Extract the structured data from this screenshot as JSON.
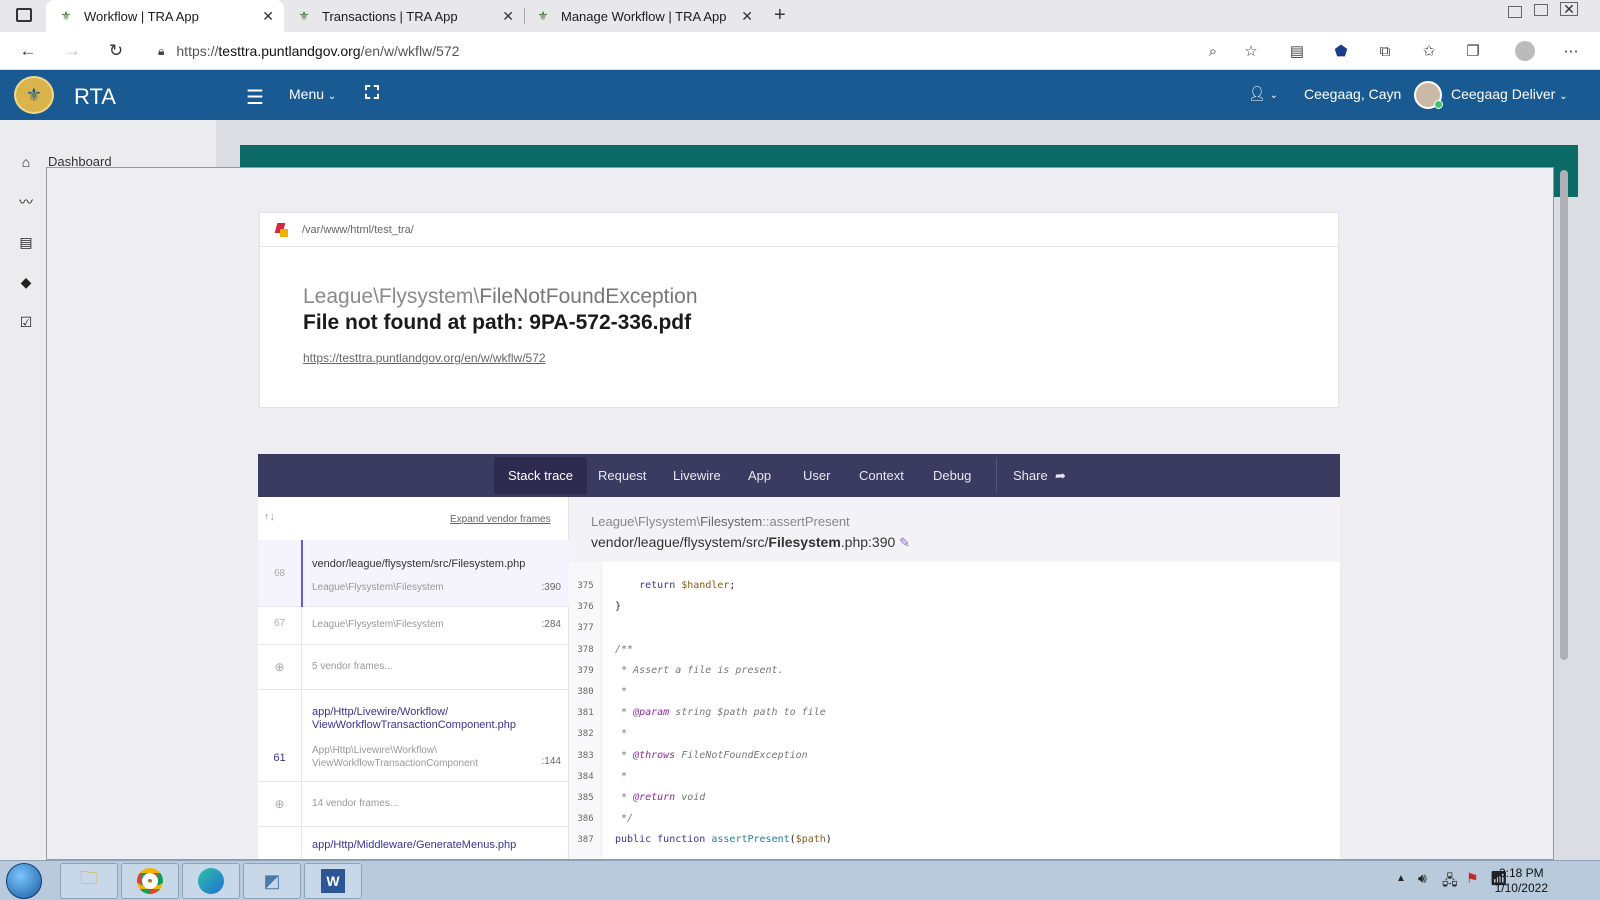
{
  "browser": {
    "tabs": [
      {
        "title": "Workflow | TRA App",
        "active": true
      },
      {
        "title": "Transactions | TRA App",
        "active": false
      },
      {
        "title": "Manage Workflow | TRA App",
        "active": false
      }
    ],
    "url_prefix": "https://",
    "url_host": "testtra.puntlandgov.org",
    "url_path": "/en/w/wkflw/572"
  },
  "app": {
    "brand": "RTA",
    "menu_label": "Menu",
    "user_short": "Ceegaag, Cayn",
    "user_full": "Ceegaag Deliver",
    "accent": "#1a5a93"
  },
  "sidebar": {
    "dashboard_label": "Dashboard"
  },
  "error": {
    "root_path": "/var/www/html/test_tra/",
    "exception_ns": "League\\Flysystem\\",
    "exception_name": "FileNotFoundException",
    "message": "File not found at path: 9PA-572-336.pdf",
    "url": "https://testtra.puntlandgov.org/en/w/wkflw/572"
  },
  "nav": {
    "items": [
      "Stack trace",
      "Request",
      "Livewire",
      "App",
      "User",
      "Context",
      "Debug"
    ],
    "share": "Share"
  },
  "frames": {
    "expand_label": "Expand vendor frames",
    "rows": [
      {
        "num": "68",
        "file": "vendor/league/flysystem/src/Filesystem.php",
        "cls": "League\\Flysystem\\Filesystem",
        "line": ":390"
      },
      {
        "num": "67",
        "cls": "League\\Flysystem\\Filesystem",
        "line": ":284"
      },
      {
        "vendor": "5 vendor frames..."
      },
      {
        "num": "61",
        "file1": "app/Http/Livewire/Workflow/",
        "file2": "ViewWorkflowTransactionComponent.php",
        "cls1": "App\\Http\\Livewire\\Workflow\\",
        "cls2": "ViewWorkflowTransactionComponent",
        "line": ":144"
      },
      {
        "vendor": "14 vendor frames..."
      },
      {
        "file": "app/Http/Middleware/GenerateMenus.php"
      }
    ]
  },
  "code": {
    "class_ns": "League\\Flysystem\\",
    "class_name": "Filesystem",
    "method": "::assertPresent",
    "file_dir": "vendor/league/flysystem/src/",
    "file_name": "Filesystem",
    "file_ext": ".php:390",
    "lines": [
      {
        "n": "375",
        "text": "    return $handler;"
      },
      {
        "n": "376",
        "text": "}"
      },
      {
        "n": "377",
        "text": ""
      },
      {
        "n": "378",
        "text": "/**"
      },
      {
        "n": "379",
        "text": " * Assert a file is present."
      },
      {
        "n": "380",
        "text": " *"
      },
      {
        "n": "381",
        "text": " * @param string $path path to file"
      },
      {
        "n": "382",
        "text": " *"
      },
      {
        "n": "383",
        "text": " * @throws FileNotFoundException"
      },
      {
        "n": "384",
        "text": " *"
      },
      {
        "n": "385",
        "text": " * @return void"
      },
      {
        "n": "386",
        "text": " */"
      },
      {
        "n": "387",
        "text": "public function assertPresent($path)"
      }
    ]
  },
  "taskbar": {
    "time": "3:18 PM",
    "date": "1/10/2022"
  }
}
